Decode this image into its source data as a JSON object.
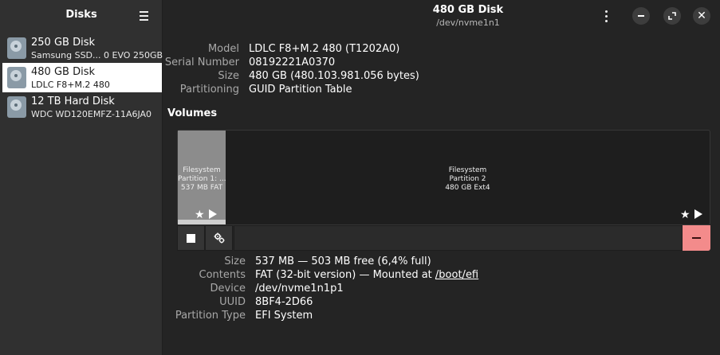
{
  "sidebar": {
    "title": "Disks",
    "items": [
      {
        "name": "250 GB Disk",
        "sub": "Samsung SSD... 0 EVO 250GB"
      },
      {
        "name": "480 GB Disk",
        "sub": "LDLC F8+M.2 480"
      },
      {
        "name": "12 TB Hard Disk",
        "sub": "WDC WD120EMFZ-11A6JA0"
      }
    ]
  },
  "header": {
    "title": "480 GB Disk",
    "subtitle": "/dev/nvme1n1"
  },
  "disk_info": {
    "model_label": "Model",
    "model": "LDLC F8+M.2 480 (T1202A0)",
    "serial_label": "Serial Number",
    "serial": "08192221A0370",
    "size_label": "Size",
    "size": "480 GB (480.103.981.056 bytes)",
    "partitioning_label": "Partitioning",
    "partitioning": "GUID Partition Table"
  },
  "volumes": {
    "title": "Volumes",
    "partitions": [
      {
        "line1": "Filesystem",
        "line2": "Partition 1: ...",
        "line3": "537 MB FAT"
      },
      {
        "line1": "Filesystem",
        "line2": "Partition 2",
        "line3": "480 GB Ext4"
      }
    ]
  },
  "partition_info": {
    "size_label": "Size",
    "size": "537 MB — 503 MB free (6,4% full)",
    "contents_label": "Contents",
    "contents_prefix": "FAT (32-bit version) — Mounted at ",
    "mount_point": "/boot/efi",
    "device_label": "Device",
    "device": "/dev/nvme1n1p1",
    "uuid_label": "UUID",
    "uuid": "8BF4-2D66",
    "type_label": "Partition Type",
    "type": "EFI System"
  },
  "icons": {
    "menu": "hamburger-menu-icon",
    "kebab": "vertical-dots-icon",
    "minimize": "minimize-icon",
    "maximize": "maximize-icon",
    "close": "close-icon",
    "star": "★",
    "stop": "stop-icon",
    "gear": "gears-icon",
    "minus": "minus-icon"
  },
  "colors": {
    "delete_button": "#f38b8b",
    "partition1_fill": "#8c8c8c"
  }
}
